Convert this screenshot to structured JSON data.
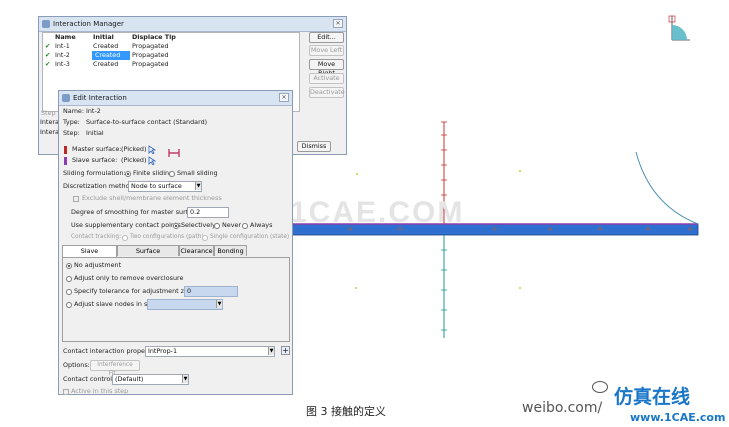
{
  "colors": {
    "accent": "#3399ff",
    "beam": "#2f6fd0",
    "red": "#cc3333",
    "teal": "#1f9e8c"
  },
  "interaction_manager": {
    "title": "Interaction Manager",
    "close": "✕",
    "columns": [
      "Name",
      "Initial",
      "Displace Tip"
    ],
    "rows": [
      {
        "check": "✔",
        "name": "Int-1",
        "initial": "Created",
        "tip": "Propagated"
      },
      {
        "check": "✔",
        "name": "Int-2",
        "initial": "Created",
        "tip": "Propagated"
      },
      {
        "check": "✔",
        "name": "Int-3",
        "initial": "Created",
        "tip": "Propagated"
      }
    ],
    "buttons": {
      "edit": "Edit...",
      "move_left": "Move Left",
      "move_right": "Move Right",
      "activate": "Activate",
      "deactivate": "Deactivate",
      "dismiss": "Dismiss"
    },
    "partial_labels": [
      "Step",
      "Intera",
      "Intera"
    ]
  },
  "edit_interaction": {
    "title": "Edit Interaction",
    "name_label": "Name:",
    "name_value": "Int-2",
    "type_label": "Type:",
    "type_value": "Surface-to-surface contact (Standard)",
    "step_label": "Step:",
    "step_value": "Initial",
    "master_label": "Master surface:",
    "master_value": "(Picked)",
    "slave_label": "Slave surface:",
    "slave_value": "(Picked)",
    "sliding_label": "Sliding formulation:",
    "sliding_options": [
      "Finite sliding",
      "Small sliding"
    ],
    "discretization_label": "Discretization method:",
    "discretization_value": "Node to surface",
    "exclude_shell": "Exclude shell/membrane element thickness",
    "smoothing_label": "Degree of smoothing for master surface:",
    "smoothing_value": "0.2",
    "supp_label": "Use supplementary contact points:",
    "supp_options": [
      "Selectively",
      "Never",
      "Always"
    ],
    "tracking_label": "Contact tracking:",
    "tracking_options": [
      "Two configurations (path)",
      "Single configuration (state)"
    ],
    "tabs": [
      "Slave Adjustment",
      "Surface Smoothing",
      "Clearance",
      "Bonding"
    ],
    "adjust_options": [
      "No adjustment",
      "Adjust only to remove overclosure",
      "Specify tolerance for adjustment zone:",
      "Adjust slave nodes in set:"
    ],
    "tolerance_value": "0",
    "property_label": "Contact interaction property:",
    "property_value": "IntProp-1",
    "options_label": "Options:",
    "options_button": "Interference Fit...",
    "controls_label": "Contact controls:",
    "controls_value": "(Default)",
    "active_label": "Active in this step"
  },
  "watermark": "1CAE.COM",
  "caption": "图 3   接触的定义",
  "weibo_text": "weibo.com/",
  "logo_cn": "仿真在线",
  "logo_url": "www.1CAE.com"
}
